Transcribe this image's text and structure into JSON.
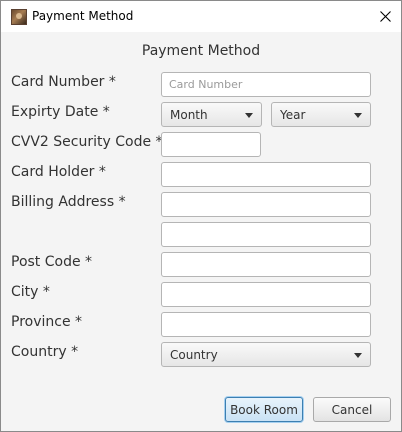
{
  "window": {
    "title": "Payment Method"
  },
  "form": {
    "heading": "Payment Method",
    "card_number": {
      "label": "Card Number *",
      "placeholder": "Card Number",
      "value": ""
    },
    "expiry_date": {
      "label": "Expirty Date *",
      "month": {
        "selected": "Month"
      },
      "year": {
        "selected": "Year"
      }
    },
    "cvv2": {
      "label": "CVV2 Security Code *",
      "value": ""
    },
    "card_holder": {
      "label": "Card Holder *",
      "value": ""
    },
    "billing_address": {
      "label": "Billing Address *",
      "line1": "",
      "line2": ""
    },
    "post_code": {
      "label": "Post Code *",
      "value": ""
    },
    "city": {
      "label": "City *",
      "value": ""
    },
    "province": {
      "label": "Province *",
      "value": ""
    },
    "country": {
      "label": "Country *",
      "selected": "Country"
    }
  },
  "buttons": {
    "book_room": "Book Room",
    "cancel": "Cancel"
  },
  "icons": {
    "app": "app-icon",
    "close": "close-icon",
    "dropdown": "chevron-down-icon"
  },
  "colors": {
    "client_bg": "#f4f4f4",
    "default_button_border": "#3c7fb1",
    "default_button_fill": "#c9e2f5"
  }
}
